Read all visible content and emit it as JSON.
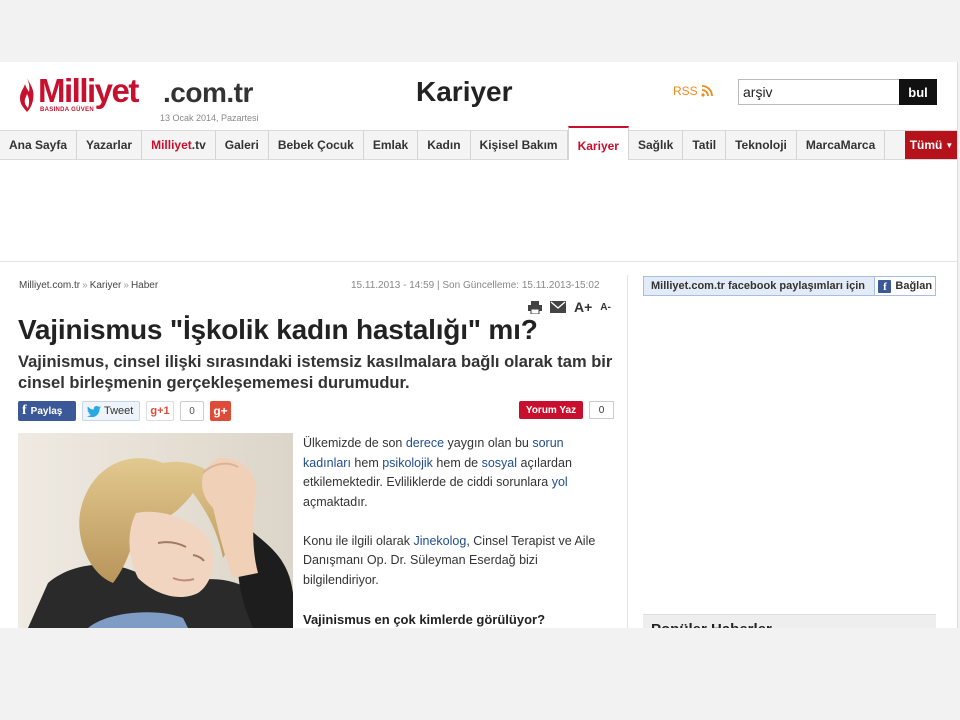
{
  "header": {
    "logo_word": "Milliyet",
    "logo_domain": ".com.tr",
    "logo_tagline": "BASINDA GÜVEN",
    "date": "13 Ocak 2014, Pazartesi",
    "section_title": "Kariyer",
    "rss_label": "RSS",
    "search_value": "arşiv",
    "search_button": "bul"
  },
  "nav": {
    "items": [
      {
        "label": "Ana Sayfa"
      },
      {
        "label": "Yazarlar"
      },
      {
        "label": "Galeri"
      },
      {
        "label": "Bebek Çocuk"
      },
      {
        "label": "Emlak"
      },
      {
        "label": "Kadın"
      },
      {
        "label": "Kişisel Bakım"
      },
      {
        "label": "Kariyer"
      },
      {
        "label": "Sağlık"
      },
      {
        "label": "Tatil"
      },
      {
        "label": "Teknoloji"
      },
      {
        "label": "MarcaMarca"
      }
    ],
    "tv_main": "Milliyet",
    "tv_suffix": ".tv",
    "more_label": "Tümü",
    "active": "Kariyer"
  },
  "article": {
    "breadcrumb": [
      "Milliyet.com.tr",
      "Kariyer",
      "Haber"
    ],
    "published": "15.11.2013 - 14:59",
    "updated": "Son Güncelleme: 15.11.2013-15:02",
    "font_increase": "A+",
    "font_decrease": "A-",
    "headline": "Vajinismus \"İşkolik kadın hastalığı\" mı?",
    "spot": "Vajinismus, cinsel ilişki sırasındaki istemsiz kasılmalara bağlı olarak tam bir cinsel birleşmenin gerçekleşememesi durumudur.",
    "share": {
      "facebook": "Paylaş",
      "twitter": "Tweet",
      "gplus": "g+1",
      "gplus_count": "0",
      "gplus_share": "g+"
    },
    "comment_button": "Yorum Yaz",
    "comment_count": "0",
    "paragraph1": [
      {
        "text": "Ülkemizde de son ",
        "link": false
      },
      {
        "text": "derece",
        "link": true
      },
      {
        "text": " yaygın olan bu ",
        "link": false
      },
      {
        "text": "sorun",
        "link": true
      },
      {
        "text": " ",
        "link": false
      },
      {
        "text": "kadınları",
        "link": true
      },
      {
        "text": " hem ",
        "link": false
      },
      {
        "text": "psikolojik",
        "link": true
      },
      {
        "text": " hem de ",
        "link": false
      },
      {
        "text": "sosyal",
        "link": true
      },
      {
        "text": " açılardan etkilemektedir. Evliliklerde de ciddi sorunlara ",
        "link": false
      },
      {
        "text": "yol",
        "link": true
      },
      {
        "text": " açmaktadır.",
        "link": false
      }
    ],
    "paragraph2": [
      {
        "text": "Konu ile ilgili olarak ",
        "link": false
      },
      {
        "text": "Jinekolog",
        "link": true
      },
      {
        "text": ", Cinsel Terapist ve Aile Danışmanı Op. Dr. Süleyman Eserdağ bizi bilgilendiriyor.",
        "link": false
      }
    ],
    "subheading": "Vajinismus en çok kimlerde görülüyor?"
  },
  "sidebar": {
    "fb_label": "Milliyet.com.tr facebook paylaşımları için",
    "fb_connect": "Bağlan",
    "popular_title": "Popüler Haberler"
  },
  "colors": {
    "brand_red": "#c8102e",
    "facebook_blue": "#3b5998",
    "link_blue": "#1f4e8c",
    "rss_orange": "#f28a1b"
  }
}
